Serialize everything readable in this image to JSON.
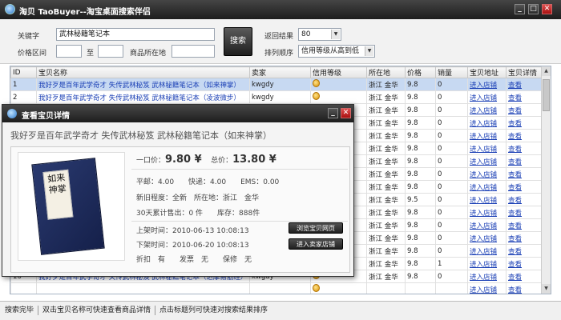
{
  "window": {
    "title": "淘贝 TaoBuyer--淘宝桌面搜索伴侣"
  },
  "search": {
    "keyword_label": "关键字",
    "keyword_value": "武林秘籍笔记本",
    "price_label": "价格区间",
    "to_label": "至",
    "location_label": "商品所在地",
    "search_button": "搜索",
    "results_label": "返回结果",
    "results_value": "80",
    "sort_label": "排列顺序",
    "sort_value": "信用等级从高到低"
  },
  "table": {
    "columns": [
      "ID",
      "宝贝名称",
      "卖家",
      "信用等级",
      "所在地",
      "价格",
      "销量",
      "宝贝地址",
      "宝贝详情"
    ],
    "rows": [
      {
        "id": "1",
        "name": "我好歹是百年武学奇才 失传武林秘笈 武林秘籍笔记本（如来神掌）",
        "seller": "kwgdy",
        "loc": "浙江 金华",
        "price": "9.8",
        "sales": "0",
        "addr": "进入店铺",
        "detail": "查看"
      },
      {
        "id": "2",
        "name": "我好歹是百年武学奇才 失传武林秘笈 武林秘籍笔记本（凌波微步）",
        "seller": "kwgdy",
        "loc": "浙江 金华",
        "price": "9.8",
        "sales": "0",
        "addr": "进入店铺",
        "detail": "查看"
      },
      {
        "id": "",
        "name": "",
        "seller": "",
        "loc": "浙江 金华",
        "price": "9.8",
        "sales": "0",
        "addr": "进入店铺",
        "detail": "查看"
      },
      {
        "id": "",
        "name": "",
        "seller": "",
        "loc": "浙江 金华",
        "price": "9.8",
        "sales": "0",
        "addr": "进入店铺",
        "detail": "查看"
      },
      {
        "id": "",
        "name": "",
        "seller": "",
        "loc": "浙江 金华",
        "price": "9.8",
        "sales": "0",
        "addr": "进入店铺",
        "detail": "查看"
      },
      {
        "id": "",
        "name": "",
        "seller": "",
        "loc": "浙江 金华",
        "price": "9.8",
        "sales": "0",
        "addr": "进入店铺",
        "detail": "查看"
      },
      {
        "id": "",
        "name": "",
        "seller": "",
        "loc": "浙江 金华",
        "price": "9.8",
        "sales": "0",
        "addr": "进入店铺",
        "detail": "查看"
      },
      {
        "id": "",
        "name": "",
        "seller": "",
        "loc": "浙江 金华",
        "price": "9.8",
        "sales": "0",
        "addr": "进入店铺",
        "detail": "查看"
      },
      {
        "id": "",
        "name": "",
        "seller": "",
        "loc": "浙江 金华",
        "price": "9.8",
        "sales": "0",
        "addr": "进入店铺",
        "detail": "查看"
      },
      {
        "id": "",
        "name": "",
        "seller": "",
        "loc": "浙江 金华",
        "price": "9.5",
        "sales": "0",
        "addr": "进入店铺",
        "detail": "查看"
      },
      {
        "id": "",
        "name": "",
        "seller": "",
        "loc": "浙江 金华",
        "price": "9.8",
        "sales": "0",
        "addr": "进入店铺",
        "detail": "查看"
      },
      {
        "id": "",
        "name": "",
        "seller": "",
        "loc": "浙江 金华",
        "price": "9.8",
        "sales": "0",
        "addr": "进入店铺",
        "detail": "查看"
      },
      {
        "id": "",
        "name": "",
        "seller": "",
        "loc": "浙江 金华",
        "price": "9.8",
        "sales": "0",
        "addr": "进入店铺",
        "detail": "查看"
      },
      {
        "id": "",
        "name": "",
        "seller": "",
        "loc": "浙江 金华",
        "price": "9.8",
        "sales": "0",
        "addr": "进入店铺",
        "detail": "查看"
      },
      {
        "id": "",
        "name": "",
        "seller": "",
        "loc": "浙江 金华",
        "price": "9.8",
        "sales": "1",
        "addr": "进入店铺",
        "detail": "查看"
      },
      {
        "id": "16",
        "name": "我好歹是百年武学奇才 失传武林秘笈 武林秘籍笔记本（达摩易筋经）",
        "seller": "kwgdy",
        "loc": "浙江 金华",
        "price": "9.8",
        "sales": "0",
        "addr": "进入店铺",
        "detail": "查看"
      },
      {
        "id": "",
        "name": "",
        "seller": "",
        "loc": "",
        "price": "",
        "sales": "",
        "addr": "进入店铺",
        "detail": "查看"
      }
    ]
  },
  "status": {
    "done": "搜索完毕",
    "tip1": "双击宝贝名称可快速查看商品详情",
    "tip2": "点击标题列可快速对搜索结果排序"
  },
  "detail": {
    "title": "查看宝贝详情",
    "item_name": "我好歹是百年武学奇才 失传武林秘笈 武林秘籍笔记本（如来神掌）",
    "book_label": "如来神掌",
    "price_label": "一口价：",
    "price_value": "9.80 ¥",
    "total_label": "总价：",
    "total_value": "13.80 ¥",
    "shipping": "平邮：4.00　　快递：4.00　　EMS：0.00",
    "condition": "新旧程度：全新　所在地：浙江　金华",
    "sold": "30天累计售出：0 件　　库存：888件",
    "listed": "上架时间：2010-06-13 10:08:13",
    "delisted": "下架时间：2010-06-20 10:08:13",
    "extras": "折扣　有　　发票　无　　保修　无",
    "btn_browse": "浏览宝贝网页",
    "btn_shop": "进入卖家店铺"
  }
}
